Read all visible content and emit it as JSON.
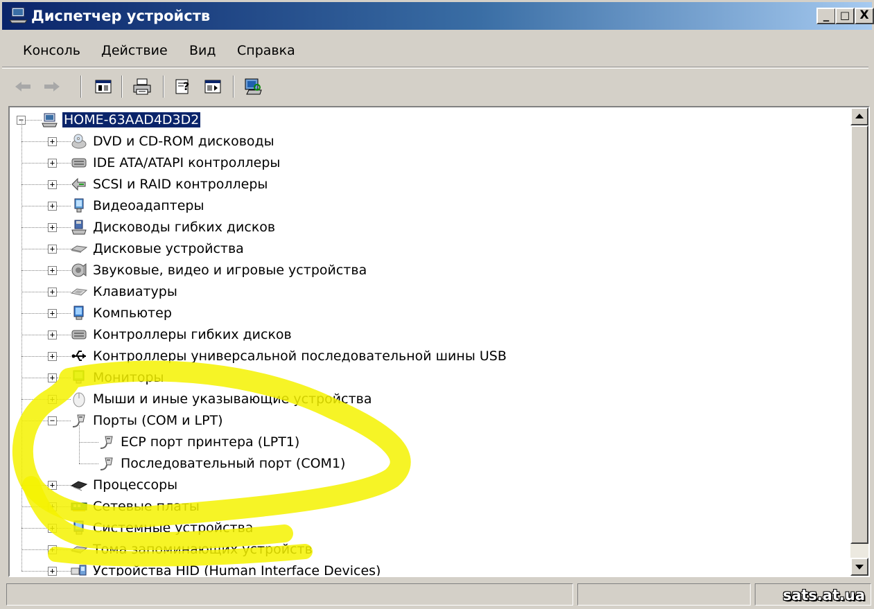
{
  "window": {
    "title": "Диспетчер устройств"
  },
  "titlebar_buttons": [
    "_",
    "□",
    "X"
  ],
  "menu": [
    "Консоль",
    "Действие",
    "Вид",
    "Справка"
  ],
  "toolbar": {
    "icons": [
      "back-arrow-icon",
      "forward-arrow-icon",
      "console-tree-icon",
      "print-icon",
      "help-icon",
      "properties-icon",
      "scan-hardware-icon"
    ]
  },
  "tree": {
    "root": {
      "label": "HOME-63AAD4D3D2",
      "selected": true,
      "expanded": true,
      "icon": "computer-icon"
    },
    "categories": [
      {
        "label": "DVD и CD-ROM дисководы",
        "icon": "cdrom-icon"
      },
      {
        "label": "IDE ATA/ATAPI контроллеры",
        "icon": "ide-controller-icon"
      },
      {
        "label": "SCSI и RAID контроллеры",
        "icon": "scsi-icon"
      },
      {
        "label": "Видеоадаптеры",
        "icon": "display-adapter-icon"
      },
      {
        "label": "Дисководы гибких дисков",
        "icon": "floppy-drive-icon"
      },
      {
        "label": "Дисковые устройства",
        "icon": "disk-drive-icon"
      },
      {
        "label": "Звуковые, видео и игровые устройства",
        "icon": "sound-icon"
      },
      {
        "label": "Клавиатуры",
        "icon": "keyboard-icon"
      },
      {
        "label": "Компьютер",
        "icon": "computer-monitor-icon"
      },
      {
        "label": "Контроллеры гибких дисков",
        "icon": "floppy-controller-icon"
      },
      {
        "label": "Контроллеры универсальной последовательной шины USB",
        "icon": "usb-icon"
      },
      {
        "label": "Мониторы",
        "icon": "monitor-icon"
      },
      {
        "label": "Мыши и иные указывающие устройства",
        "icon": "mouse-icon"
      },
      {
        "label": "Порты (COM и LPT)",
        "icon": "port-icon",
        "expanded": true,
        "children": [
          {
            "label": "ECP порт принтера (LPT1)",
            "icon": "port-icon"
          },
          {
            "label": "Последовательный порт (COM1)",
            "icon": "port-icon"
          }
        ]
      },
      {
        "label": "Процессоры",
        "icon": "processor-icon"
      },
      {
        "label": "Сетевые платы",
        "icon": "network-card-icon"
      },
      {
        "label": "Системные устройства",
        "icon": "system-device-icon"
      },
      {
        "label": "Тома запоминающих устройств",
        "icon": "storage-volume-icon"
      },
      {
        "label": "Устройства HID (Human Interface Devices)",
        "icon": "hid-icon"
      }
    ]
  },
  "statusbar": {
    "watermark": "sats.at.ua"
  },
  "colors": {
    "titlebar_start": "#0a246a",
    "titlebar_end": "#a6caf0",
    "selection": "#0a246a",
    "highlighter": "#f5f200"
  }
}
